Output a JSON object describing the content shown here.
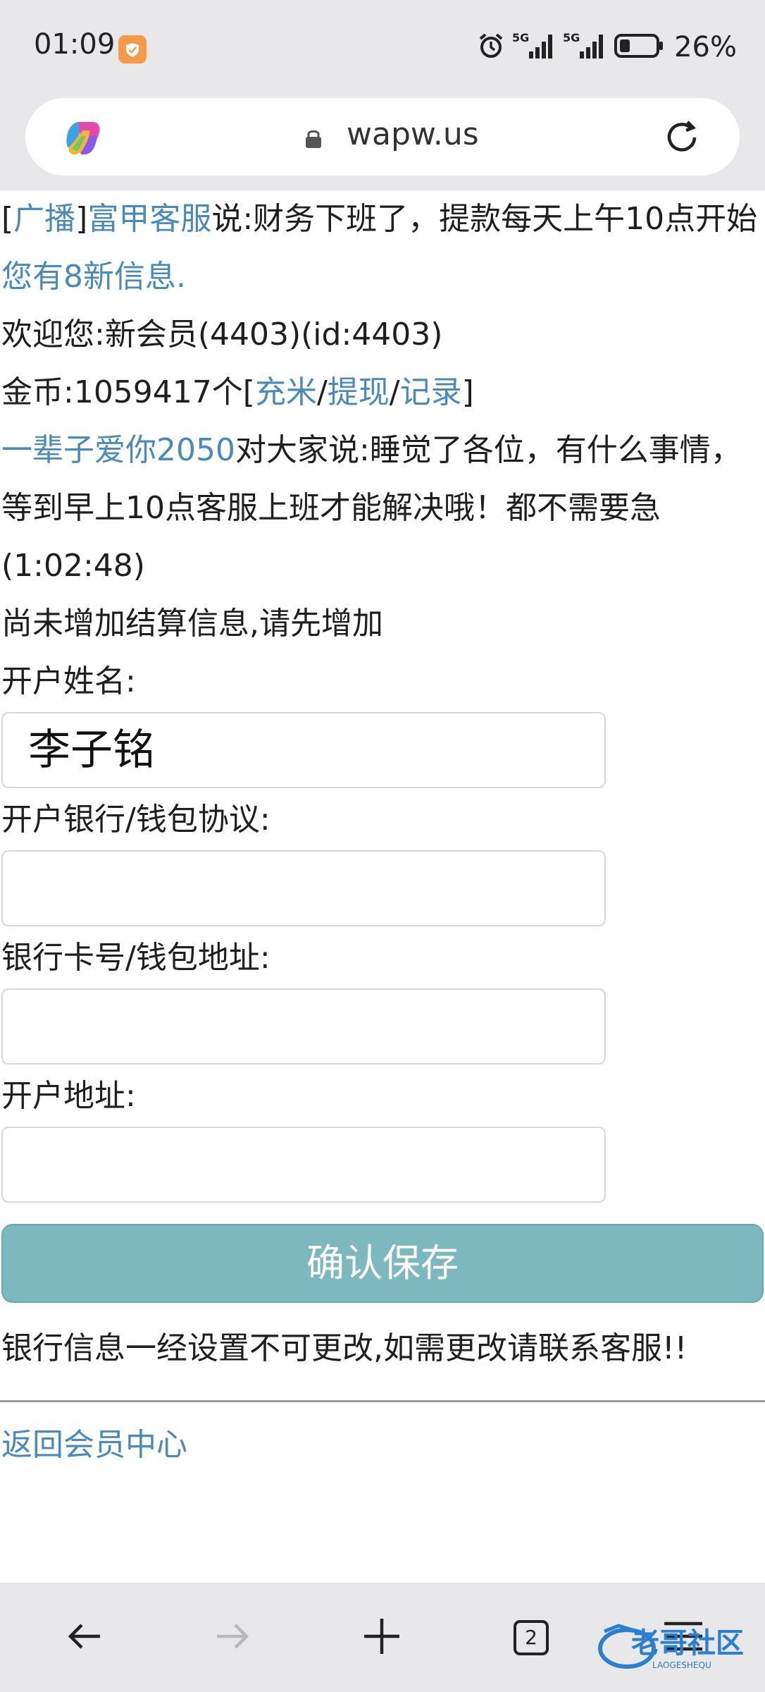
{
  "status_bar": {
    "time": "01:09",
    "network_1": "5G",
    "network_2": "5G",
    "battery_percent": "26%"
  },
  "browser": {
    "url": "wapw.us"
  },
  "broadcast": {
    "open_bracket": "[",
    "tag": "广播",
    "close_bracket": "]",
    "sender": "富甲客服",
    "message": "说:财务下班了，提款每天上午10点开始"
  },
  "new_messages_link": "您有8新信息.",
  "welcome_text": "欢迎您:新会员(4403)(id:4403)",
  "coins": {
    "prefix": "金币:1059417个[",
    "recharge_link": "充米",
    "sep1": "/",
    "withdraw_link": "提现",
    "sep2": "/",
    "records_link": "记录",
    "suffix": "]"
  },
  "chat": {
    "user": "一辈子爱你2050",
    "message": "对大家说:睡觉了各位，有什么事情，等到早上10点客服上班才能解决哦！都不需要急(1:02:48)"
  },
  "form": {
    "notice": "尚未增加结算信息,请先增加",
    "account_name_label": "开户姓名:",
    "account_name_value": "李子铭",
    "bank_label": "开户银行/钱包协议:",
    "bank_value": "",
    "card_label": "银行卡号/钱包地址:",
    "card_value": "",
    "address_label": "开户地址:",
    "address_value": "",
    "save_button": "确认保存",
    "warning": "银行信息一经设置不可更改,如需更改请联系客服!!"
  },
  "back_link": "返回会员中心",
  "bottom_nav": {
    "tab_count": "2"
  },
  "watermark": {
    "text": "老哥社区",
    "subtext": "LAOGESHEQU"
  },
  "colors": {
    "link": "#4a8ab8",
    "button": "#7eb8bf",
    "chrome": "#e8e8ea"
  }
}
